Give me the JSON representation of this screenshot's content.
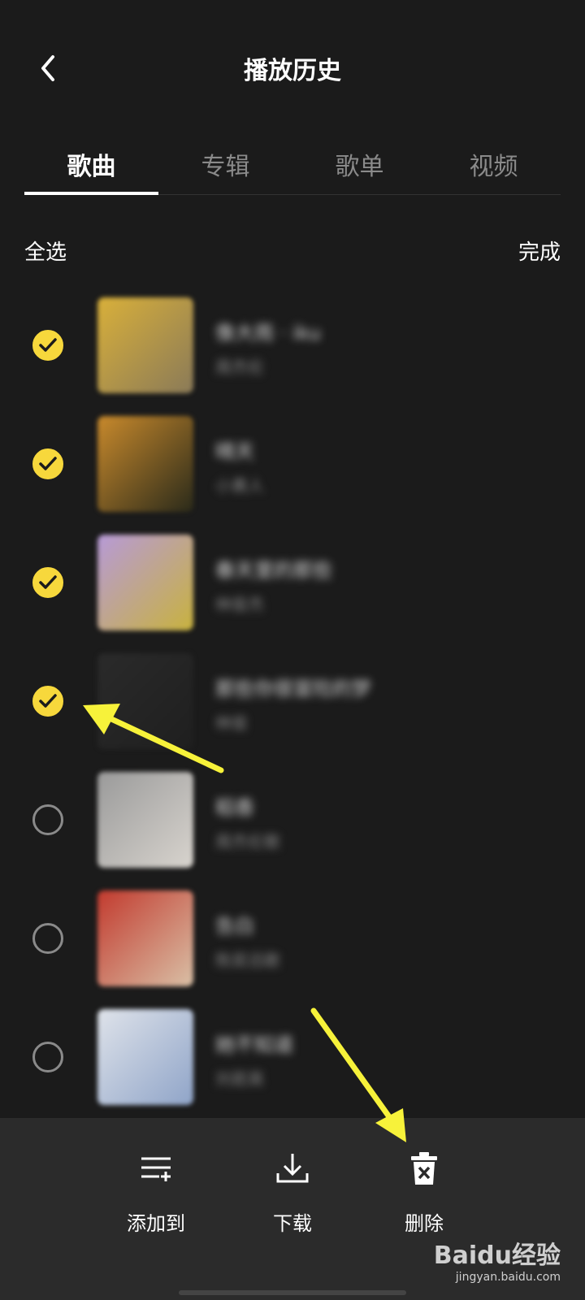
{
  "header": {
    "title": "播放历史",
    "back_icon": "chevron-left-icon"
  },
  "tabs": [
    {
      "label": "歌曲",
      "active": true
    },
    {
      "label": "专辑",
      "active": false
    },
    {
      "label": "歌单",
      "active": false
    },
    {
      "label": "视频",
      "active": false
    }
  ],
  "select_bar": {
    "select_all": "全选",
    "done": "完成"
  },
  "colors": {
    "accent": "#f7d83c",
    "background": "#1b1b1b",
    "bottom_bar": "#2b2b2b"
  },
  "songs": [
    {
      "title": "像大雨 · iku",
      "artist": "周杰伦",
      "selected": true,
      "cover_colors": [
        "#d9b03a",
        "#8a7a58"
      ]
    },
    {
      "title": "晴天",
      "artist": "小黄人",
      "selected": true,
      "cover_colors": [
        "#c98a2c",
        "#2a2a1a"
      ]
    },
    {
      "title": "春天里的那些",
      "artist": "林俊杰",
      "selected": true,
      "cover_colors": [
        "#b79ad8",
        "#c8b23e"
      ]
    },
    {
      "title": "那些你很冒险的梦",
      "artist": "林俊",
      "selected": true,
      "cover_colors": [
        "#2a2a2a",
        "#1f1f1f"
      ]
    },
    {
      "title": "稻香",
      "artist": "周杰伦歌",
      "selected": false,
      "cover_colors": [
        "#9a9a9a",
        "#d8d4ce"
      ]
    },
    {
      "title": "告白",
      "artist": "陈奕迅歌",
      "selected": false,
      "cover_colors": [
        "#c23a2e",
        "#d9c0a6"
      ]
    },
    {
      "title": "她不知道",
      "artist": "刘若英",
      "selected": false,
      "cover_colors": [
        "#dfe3ea",
        "#8fa4c8"
      ]
    }
  ],
  "actions": [
    {
      "label": "添加到",
      "icon": "add-to-playlist-icon"
    },
    {
      "label": "下载",
      "icon": "download-icon"
    },
    {
      "label": "删除",
      "icon": "trash-icon"
    }
  ],
  "watermark": {
    "brand": "Baidu经验",
    "url": "jingyan.baidu.com"
  }
}
